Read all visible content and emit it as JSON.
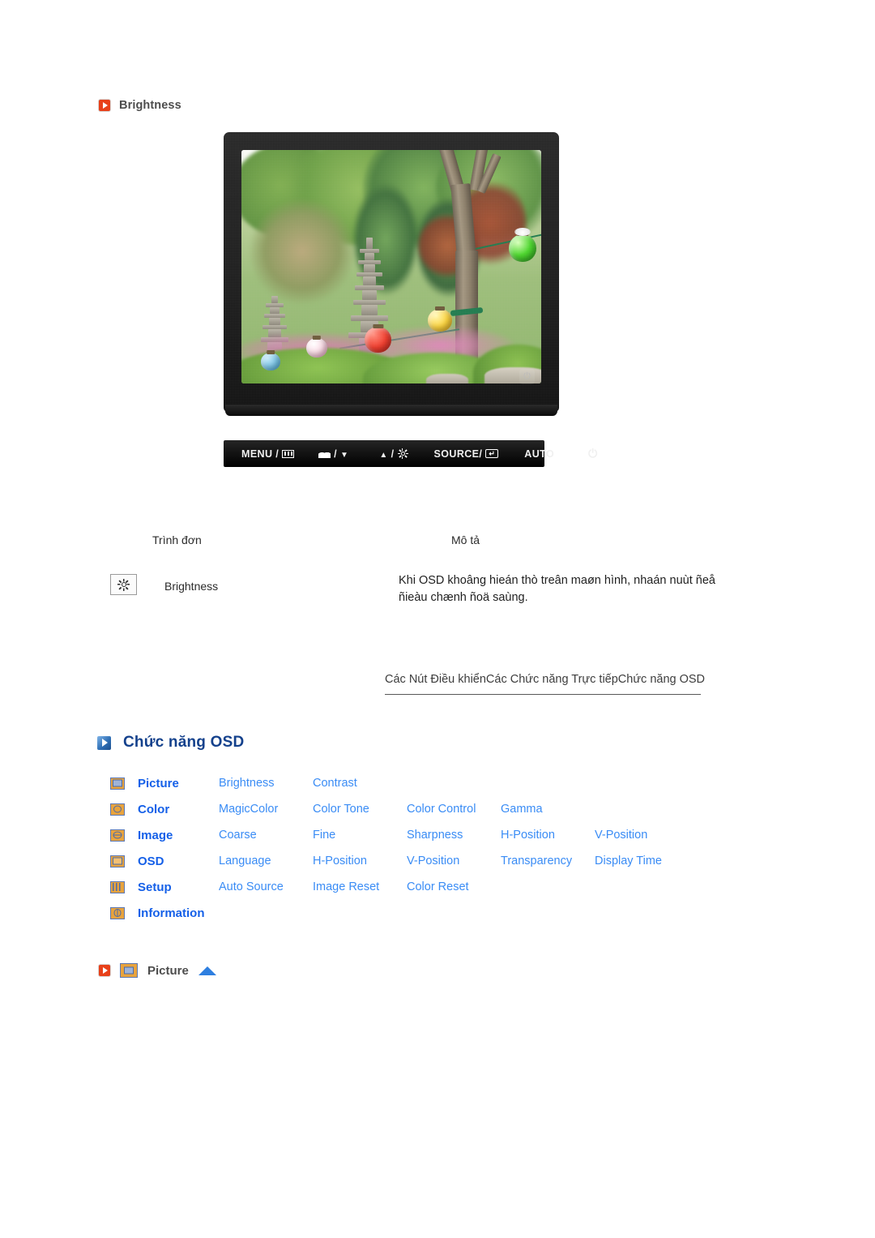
{
  "page": {
    "brightness_caption": "Brightness"
  },
  "monitor": {
    "photo_alt": "garden-photo",
    "power_icon": "power-led-icon"
  },
  "control_strip": {
    "buttons": [
      {
        "label": "MENU /",
        "icon": "menu-grid-icon"
      },
      {
        "label": "/",
        "icon": "magicbright-icon",
        "icon2": "down-arrow-icon"
      },
      {
        "label": "/",
        "icon": "up-arrow-icon",
        "icon2": "brightness-sun-icon"
      },
      {
        "label": "SOURCE/",
        "icon": "enter-key-icon"
      },
      {
        "label": "AUTO",
        "icon": ""
      },
      {
        "label": "",
        "icon": "power-icon"
      }
    ],
    "menu_label": "MENU /",
    "source_label": "SOURCE/",
    "auto_label": "AUTO",
    "slash": "/"
  },
  "desc_table": {
    "header_menu": "Trình đơn",
    "header_desc": "Mô tả",
    "rows": [
      {
        "icon": "brightness-sun-icon",
        "name": "Brightness",
        "description": "Khi OSD khoâng hieán thò treân maøn hình, nhaán nuùt ñeå ñieàu chænh ñoä saùng."
      }
    ]
  },
  "breadcrumb": {
    "items": [
      "Các Nút Điều khiển",
      "Các Chức năng Trực tiếp",
      "Chức năng OSD"
    ]
  },
  "osd_section": {
    "heading": "Chức năng OSD",
    "rows": [
      {
        "icon": "picture-icon",
        "category": "Picture",
        "items": [
          "Brightness",
          "Contrast"
        ]
      },
      {
        "icon": "color-icon",
        "category": "Color",
        "items": [
          "MagicColor",
          "Color Tone",
          "Color Control",
          "Gamma"
        ]
      },
      {
        "icon": "image-icon",
        "category": "Image",
        "items": [
          "Coarse",
          "Fine",
          "Sharpness",
          "H-Position",
          "V-Position"
        ]
      },
      {
        "icon": "osd-icon",
        "category": "OSD",
        "items": [
          "Language",
          "H-Position",
          "V-Position",
          "Transparency",
          "Display Time"
        ]
      },
      {
        "icon": "setup-icon",
        "category": "Setup",
        "items": [
          "Auto Source",
          "Image Reset",
          "Color Reset"
        ]
      },
      {
        "icon": "information-icon",
        "category": "Information",
        "items": []
      }
    ]
  },
  "picture_footer": {
    "label": "Picture",
    "bullet": "red-play-icon",
    "icon": "picture-icon",
    "arrow": "up-arrow-icon"
  },
  "colors": {
    "accent_red": "#e8411a",
    "heading_blue": "#14418c",
    "category_blue": "#1560e8",
    "link_blue": "#3a8cf5",
    "icon_orange": "#e8a33d",
    "text_gray": "#4d4d4d"
  }
}
